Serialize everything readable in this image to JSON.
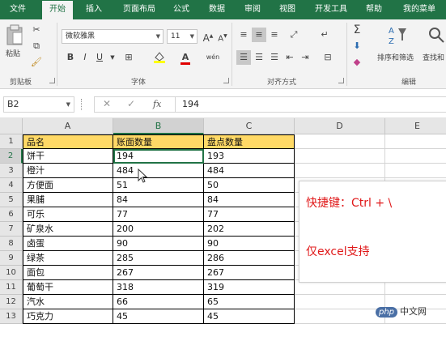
{
  "tabs": [
    "文件",
    "开始",
    "插入",
    "页面布局",
    "公式",
    "数据",
    "审阅",
    "视图",
    "开发工具",
    "帮助",
    "我的菜单"
  ],
  "active_tab": "开始",
  "ribbon": {
    "clipboard": {
      "label": "剪贴板",
      "paste": "粘贴"
    },
    "font": {
      "label": "字体",
      "font_name": "微软雅黑",
      "font_size": "11",
      "grow": "A",
      "shrink": "A",
      "bold": "B",
      "italic": "I",
      "underline": "U",
      "font_color_glyph": "A",
      "phonetic": "wén"
    },
    "alignment": {
      "label": "对齐方式"
    },
    "editing": {
      "label": "编辑",
      "sort_filter": "排序和筛选",
      "find_select": "查找和"
    }
  },
  "formula_bar": {
    "name_box": "B2",
    "fx": "fx",
    "value": "194"
  },
  "columns": [
    "A",
    "B",
    "C",
    "D",
    "E"
  ],
  "rows": [
    [
      "品名",
      "账面数量",
      "盘点数量"
    ],
    [
      "饼干",
      "194",
      "193"
    ],
    [
      "橙汁",
      "484",
      "484"
    ],
    [
      "方便面",
      "51",
      "50"
    ],
    [
      "果脯",
      "84",
      "84"
    ],
    [
      "可乐",
      "77",
      "77"
    ],
    [
      "矿泉水",
      "200",
      "202"
    ],
    [
      "卤蛋",
      "90",
      "90"
    ],
    [
      "绿茶",
      "285",
      "286"
    ],
    [
      "面包",
      "267",
      "267"
    ],
    [
      "葡萄干",
      "318",
      "319"
    ],
    [
      "汽水",
      "66",
      "65"
    ],
    [
      "巧克力",
      "45",
      "45"
    ]
  ],
  "row_numbers": [
    "1",
    "2",
    "3",
    "4",
    "5",
    "6",
    "7",
    "8",
    "9",
    "10",
    "11",
    "12",
    "13"
  ],
  "note": {
    "line1": "快捷键：Ctrl + \\",
    "line2": "仅excel支持"
  },
  "watermark": {
    "logo": "php",
    "text": "中文网"
  },
  "colors": {
    "accent": "#217346",
    "header_fill": "#ffd966",
    "note_text": "#e0191a"
  }
}
